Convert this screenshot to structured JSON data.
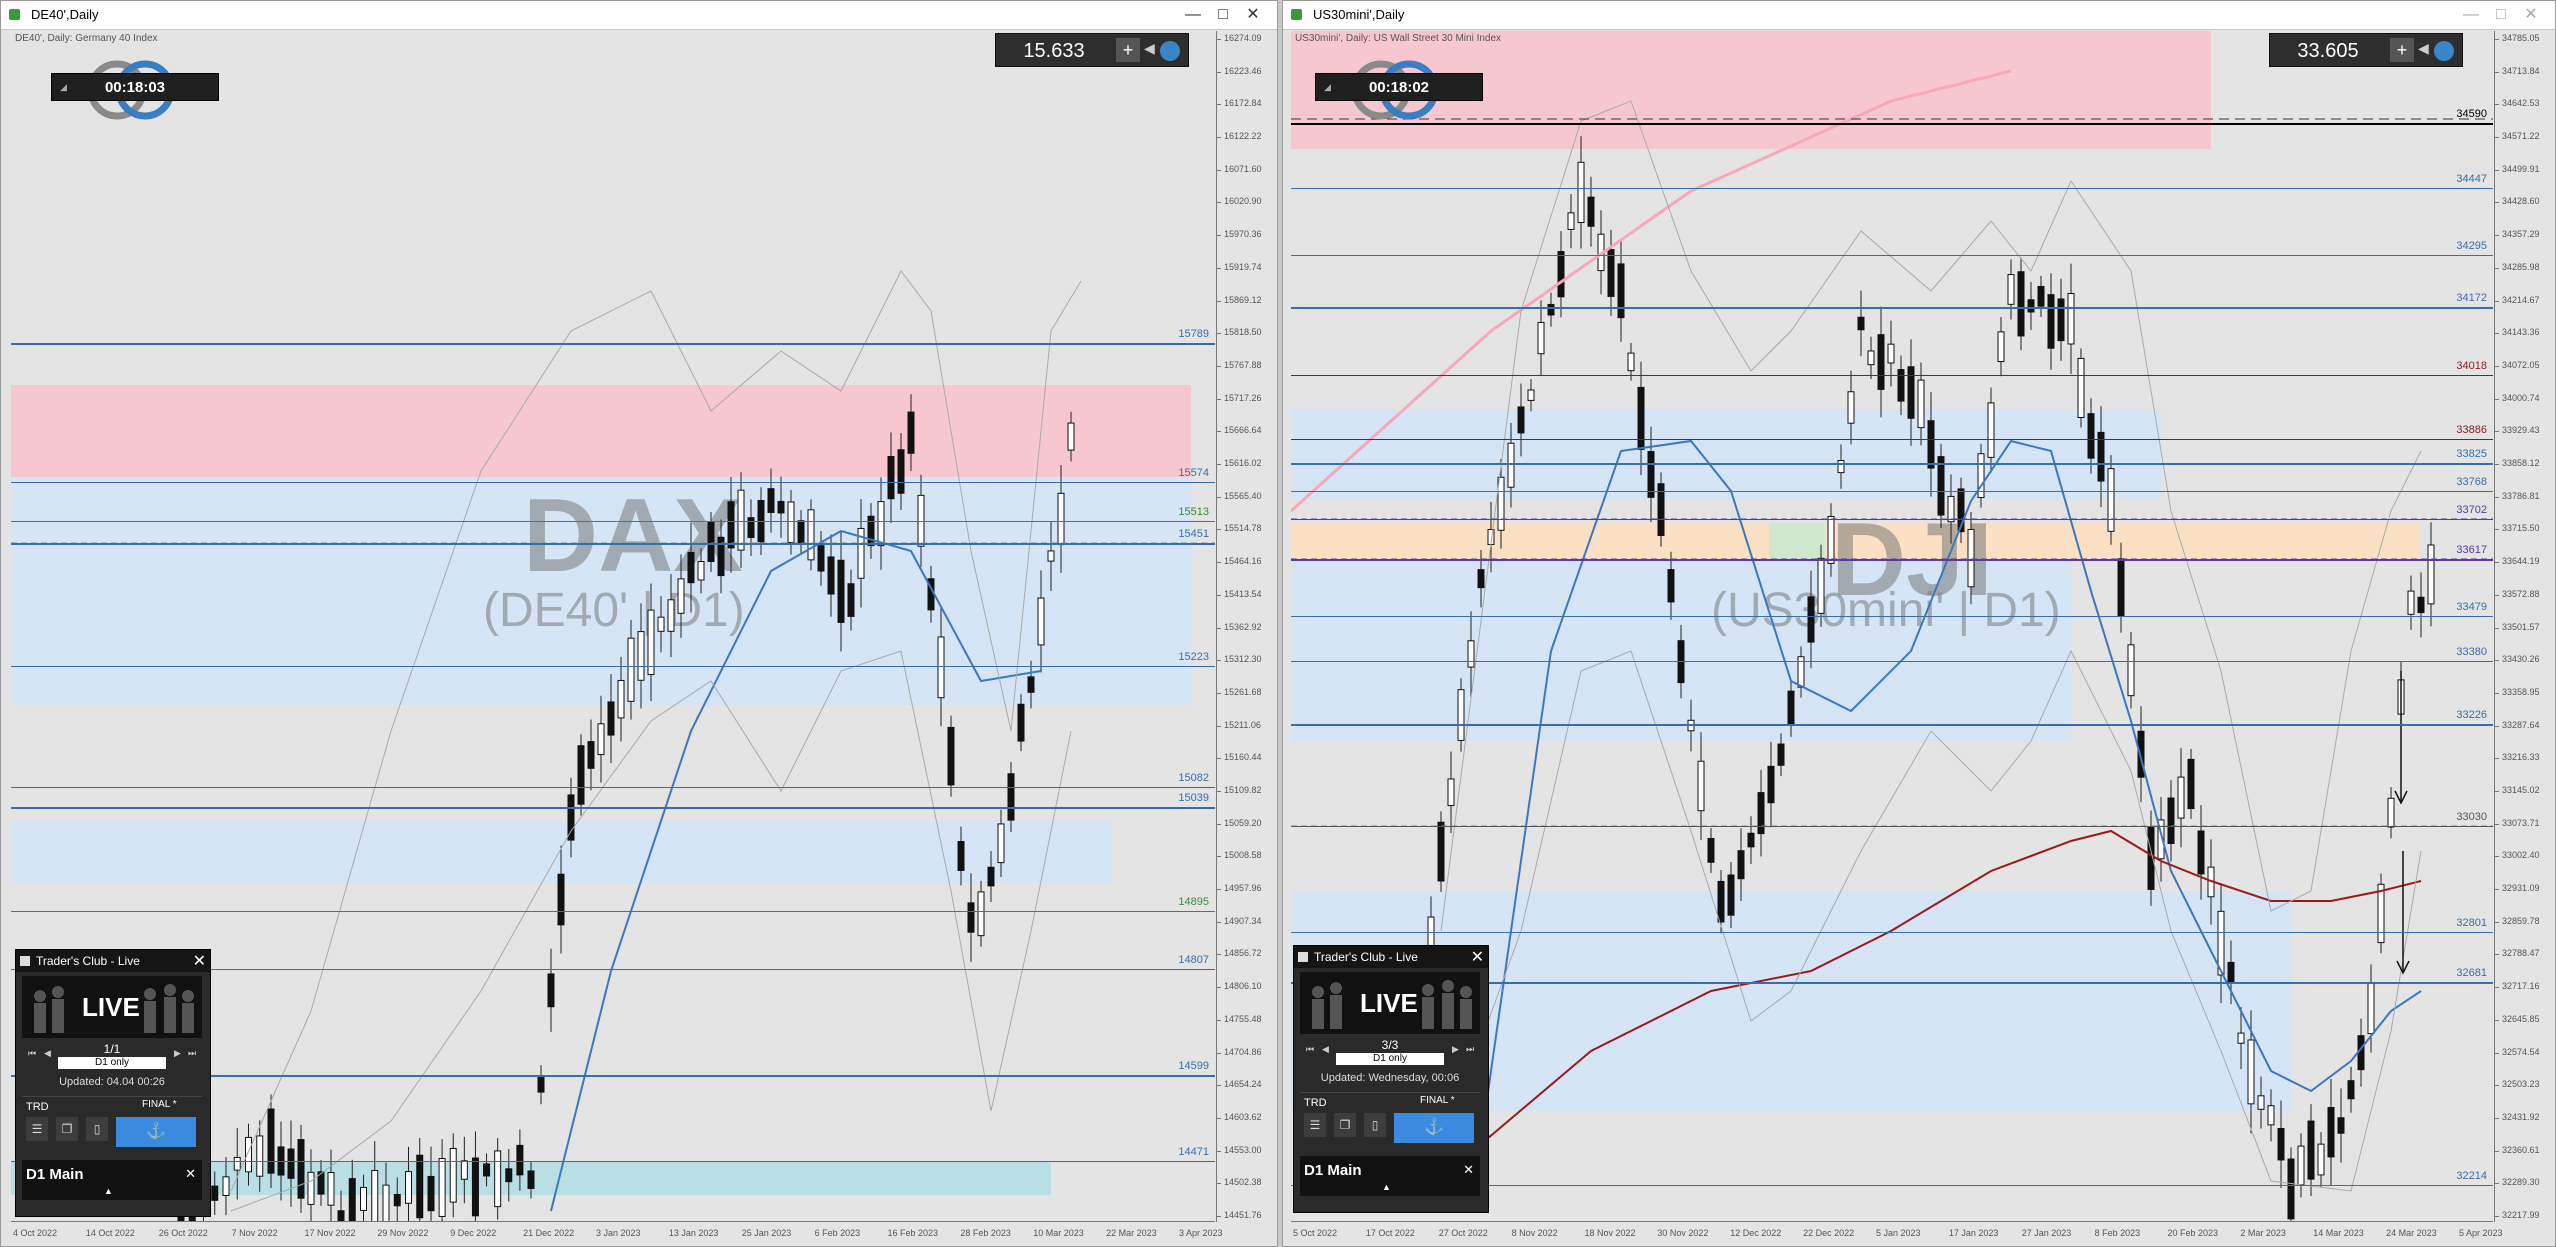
{
  "left": {
    "title": "DE40',Daily",
    "subtitle": "DE40', Daily:  Germany 40 Index",
    "watermark_main": "DAX",
    "watermark_sub": "(DE40' | D1)",
    "spread": "15.633",
    "timer": "00:18:03",
    "window_controls": [
      "—",
      "□",
      "✕"
    ],
    "y_ticks": [
      "16274.09",
      "16223.46",
      "16172.84",
      "16122.22",
      "16071.60",
      "16020.90",
      "15970.36",
      "15919.74",
      "15869.12",
      "15818.50",
      "15767.88",
      "15717.26",
      "15666.64",
      "15616.02",
      "15565.40",
      "15514.78",
      "15464.16",
      "15413.54",
      "15362.92",
      "15312.30",
      "15261.68",
      "15211.06",
      "15160.44",
      "15109.82",
      "15059.20",
      "15008.58",
      "14957.96",
      "14907.34",
      "14856.72",
      "14806.10",
      "14755.48",
      "14704.86",
      "14654.24",
      "14603.62",
      "14553.00",
      "14502.38",
      "14451.76"
    ],
    "x_ticks": [
      "4 Oct 2022",
      "14 Oct 2022",
      "26 Oct 2022",
      "7 Nov 2022",
      "17 Nov 2022",
      "29 Nov 2022",
      "9 Dec 2022",
      "21 Dec 2022",
      "3 Jan 2023",
      "13 Jan 2023",
      "25 Jan 2023",
      "6 Feb 2023",
      "16 Feb 2023",
      "28 Feb 2023",
      "10 Mar 2023",
      "22 Mar 2023",
      "3 Apr 2023"
    ],
    "levels": [
      {
        "label": "15789",
        "color": "#3a6ea8"
      },
      {
        "label": "15574",
        "color": "#3a6ea8"
      },
      {
        "label": "15513",
        "color": "#3a8a3a"
      },
      {
        "label": "15451",
        "color": "#3a6ea8"
      },
      {
        "label": "15223",
        "color": "#3a6ea8"
      },
      {
        "label": "15082",
        "color": "#3a6ea8"
      },
      {
        "label": "15039",
        "color": "#3a6ea8"
      },
      {
        "label": "14895",
        "color": "#3a8a3a"
      },
      {
        "label": "14807",
        "color": "#3a6ea8"
      },
      {
        "label": "14599",
        "color": "#3a6ea8"
      },
      {
        "label": "14471",
        "color": "#3a6ea8"
      }
    ],
    "panel": {
      "title": "Trader's Club - Live",
      "live": "LIVE",
      "page": "1/1",
      "filter": "D1 only",
      "updated": "Updated: 04.04 00:26",
      "trd": "TRD",
      "final": "FINAL *",
      "main": "D1 Main"
    }
  },
  "right": {
    "title": "US30mini',Daily",
    "subtitle": "US30mini', Daily:  US Wall Street 30 Mini Index",
    "watermark_main": "DJI",
    "watermark_sub": "(US30mini' | D1)",
    "spread": "33.605",
    "timer": "00:18:02",
    "window_controls": [
      "—",
      "□",
      "✕"
    ],
    "y_ticks": [
      "34785.05",
      "34713.84",
      "34642.53",
      "34571.22",
      "34499.91",
      "34428.60",
      "34357.29",
      "34285.98",
      "34214.67",
      "34143.36",
      "34072.05",
      "34000.74",
      "33929.43",
      "33858.12",
      "33786.81",
      "33715.50",
      "33644.19",
      "33572.88",
      "33501.57",
      "33430.26",
      "33358.95",
      "33287.64",
      "33216.33",
      "33145.02",
      "33073.71",
      "33002.40",
      "32931.09",
      "32859.78",
      "32788.47",
      "32717.16",
      "32645.85",
      "32574.54",
      "32503.23",
      "32431.92",
      "32360.61",
      "32289.30",
      "32217.99"
    ],
    "x_ticks": [
      "5 Oct 2022",
      "17 Oct 2022",
      "27 Oct 2022",
      "8 Nov 2022",
      "18 Nov 2022",
      "30 Nov 2022",
      "12 Dec 2022",
      "22 Dec 2022",
      "5 Jan 2023",
      "17 Jan 2023",
      "27 Jan 2023",
      "8 Feb 2023",
      "20 Feb 2023",
      "2 Mar 2023",
      "14 Mar 2023",
      "24 Mar 2023",
      "5 Apr 2023"
    ],
    "levels": [
      {
        "label": "34590",
        "color": "#000000"
      },
      {
        "label": "34447",
        "color": "#3a6ea8"
      },
      {
        "label": "34295",
        "color": "#3a6ea8"
      },
      {
        "label": "34172",
        "color": "#3a6ea8"
      },
      {
        "label": "34018",
        "color": "#8a1a1a"
      },
      {
        "label": "33886",
        "color": "#8a1a1a"
      },
      {
        "label": "33825",
        "color": "#3a6ea8"
      },
      {
        "label": "33768",
        "color": "#3a6ea8"
      },
      {
        "label": "33702",
        "color": "#5a3a9a"
      },
      {
        "label": "33617",
        "color": "#5a3a9a"
      },
      {
        "label": "33479",
        "color": "#3a6ea8"
      },
      {
        "label": "33380",
        "color": "#3a6ea8"
      },
      {
        "label": "33226",
        "color": "#3a6ea8"
      },
      {
        "label": "33030",
        "color": "#555555"
      },
      {
        "label": "32801",
        "color": "#3a6ea8"
      },
      {
        "label": "32681",
        "color": "#3a6ea8"
      },
      {
        "label": "32214",
        "color": "#3a6ea8"
      }
    ],
    "panel": {
      "title": "Trader's Club - Live",
      "live": "LIVE",
      "page": "3/3",
      "filter": "D1 only",
      "updated": "Updated: Wednesday, 00:06",
      "trd": "TRD",
      "final": "FINAL *",
      "main": "D1 Main"
    }
  }
}
